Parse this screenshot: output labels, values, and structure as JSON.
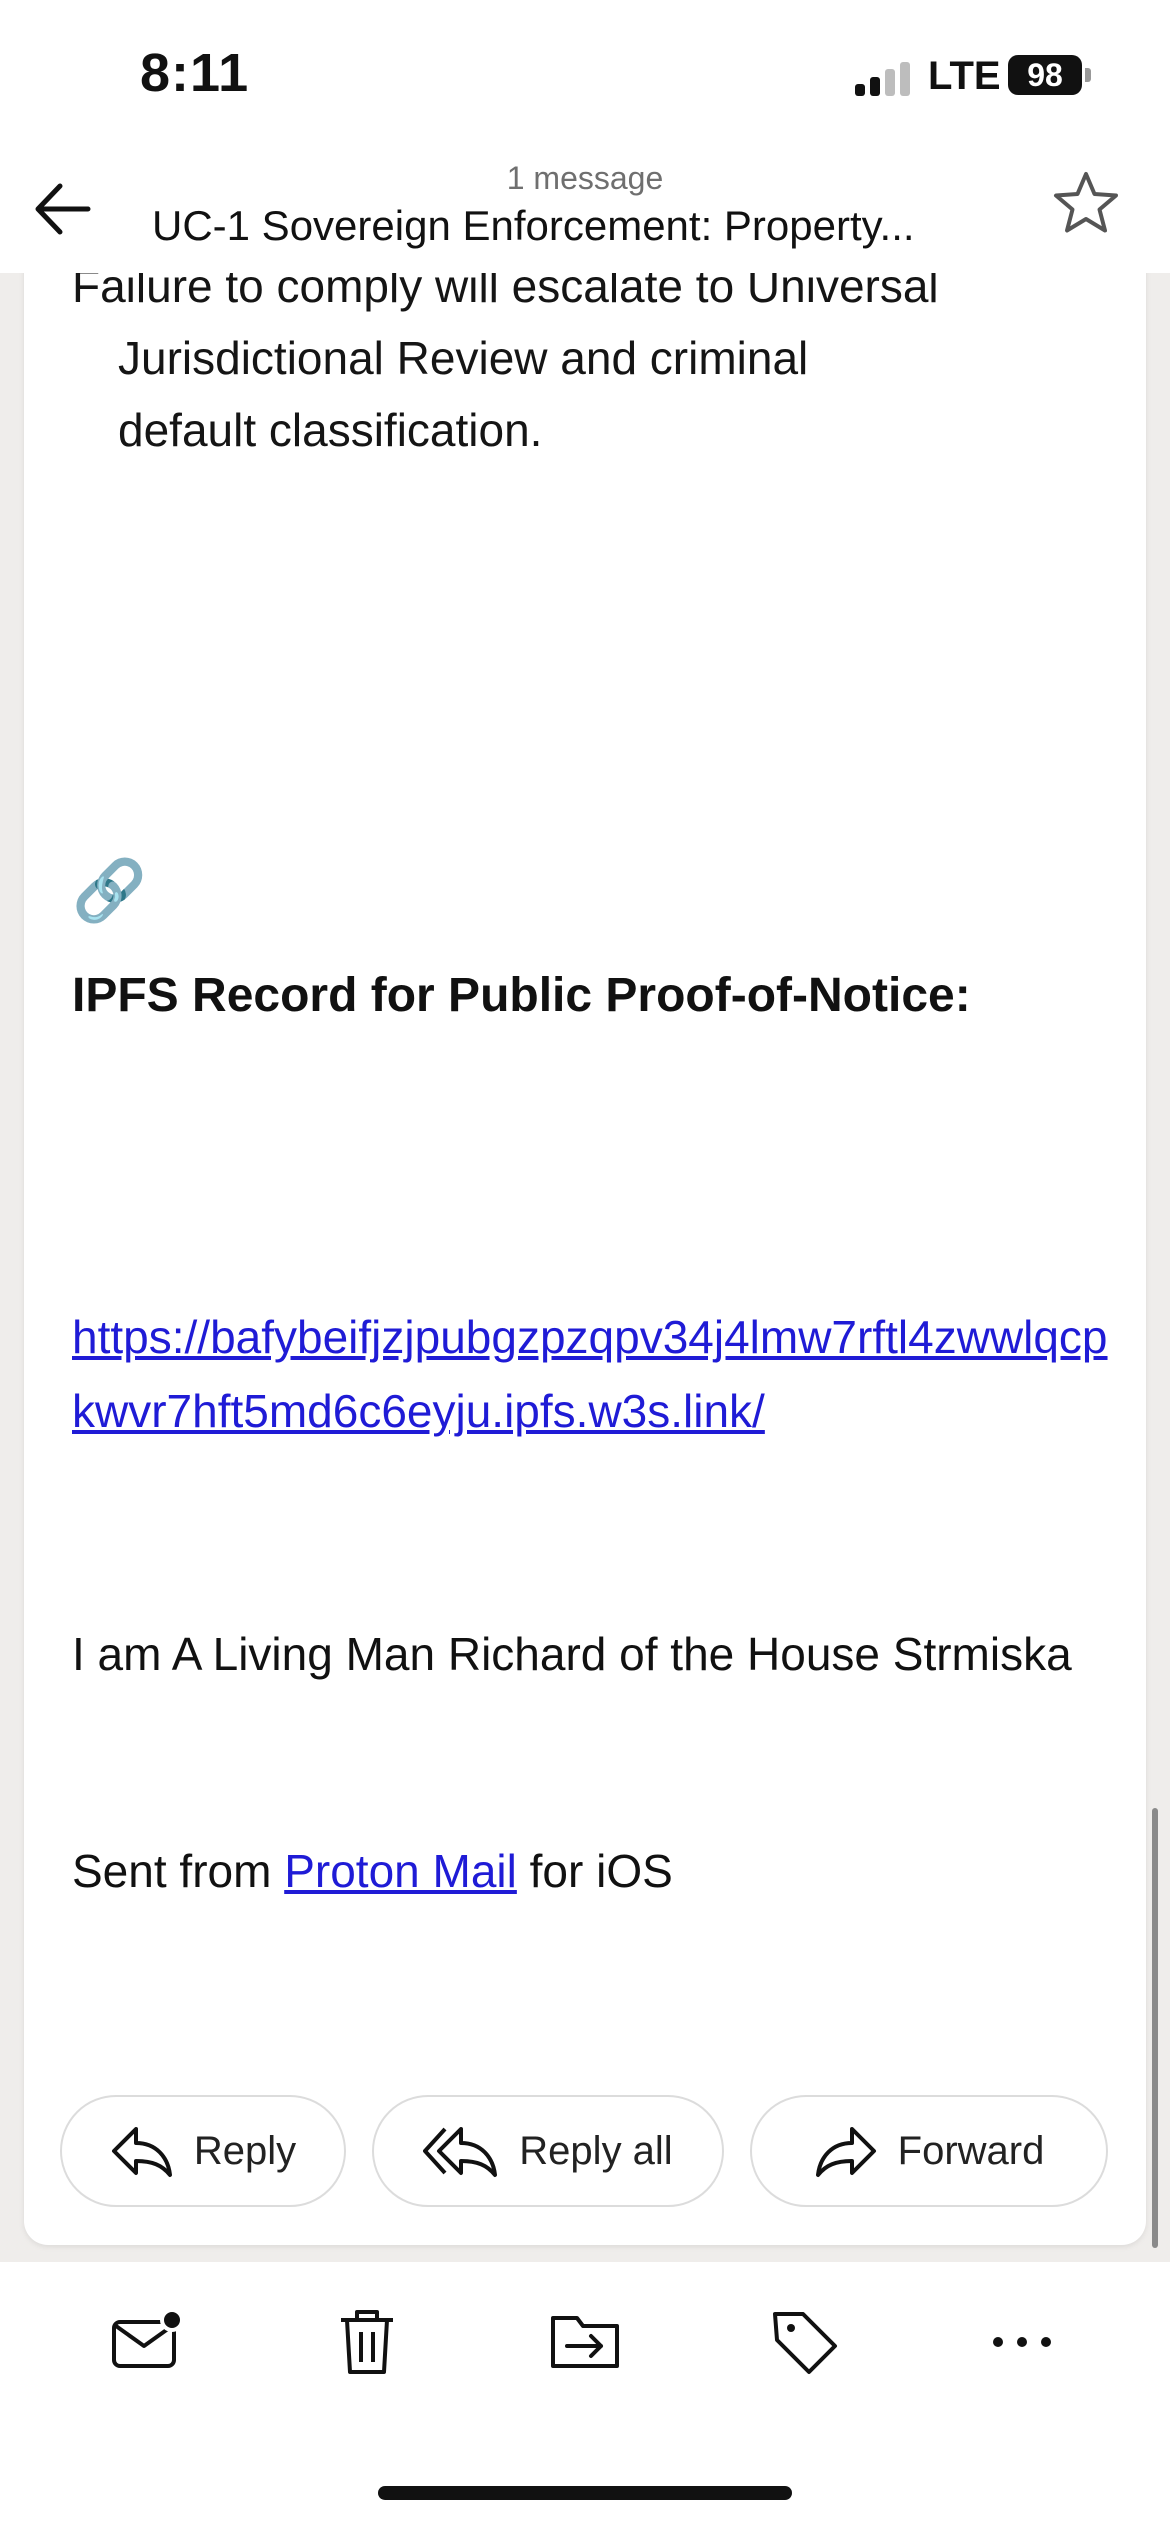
{
  "status_bar": {
    "time": "8:11",
    "network": "LTE",
    "battery": "98"
  },
  "header": {
    "message_count": "1 message",
    "subject": "UC-1 Sovereign Enforcement: Property..."
  },
  "message": {
    "partial_lines": [
      "Failure to comply will escalate to Universal",
      "Jurisdictional Review and criminal",
      "default classification."
    ],
    "link_emoji": "🔗",
    "ipfs_heading": "IPFS Record for Public Proof-of-Notice:",
    "ipfs_url": "https://bafybeifjzjpubgzpzqpv34j4lmw7rftl4zwwlqcpkwvr7hft5md6c6eyju.ipfs.w3s.link/",
    "signature_line": "I am A Living Man Richard of the House Strmiska",
    "sent_prefix": "Sent from ",
    "sent_link": "Proton Mail",
    "sent_suffix": " for iOS"
  },
  "actions": {
    "reply": "Reply",
    "reply_all": "Reply all",
    "forward": "Forward"
  },
  "toolbar_icons": [
    "mark-unread-icon",
    "trash-icon",
    "move-to-folder-icon",
    "label-icon",
    "more-icon"
  ],
  "colors": {
    "link": "#1f1bd6",
    "background": "#efedeb"
  }
}
